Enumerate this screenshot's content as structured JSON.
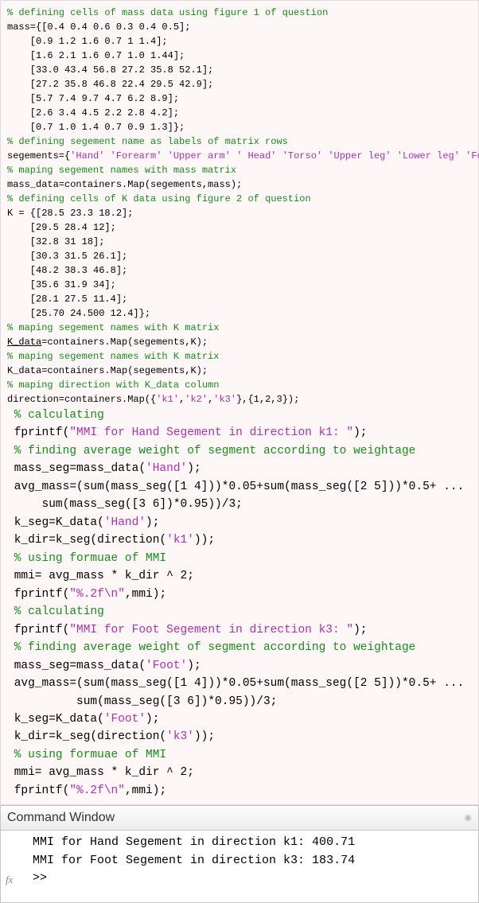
{
  "editor": {
    "lines": [
      {
        "cls": "line",
        "tokens": [
          {
            "t": "comment",
            "v": "% defining cells of mass data using figure 1 of question"
          }
        ]
      },
      {
        "cls": "line",
        "tokens": [
          {
            "v": "mass={[0.4 0.4 0.6 0.3 0.4 0.5];"
          }
        ]
      },
      {
        "cls": "line",
        "tokens": [
          {
            "v": "    [0.9 1.2 1.6 0.7 1 1.4];"
          }
        ]
      },
      {
        "cls": "line",
        "tokens": [
          {
            "v": "    [1.6 2.1 1.6 0.7 1.0 1.44];"
          }
        ]
      },
      {
        "cls": "line",
        "tokens": [
          {
            "v": "    [33.0 43.4 56.8 27.2 35.8 52.1];"
          }
        ]
      },
      {
        "cls": "line",
        "tokens": [
          {
            "v": "    [27.2 35.8 46.8 22.4 29.5 42.9];"
          }
        ]
      },
      {
        "cls": "line",
        "tokens": [
          {
            "v": "    [5.7 7.4 9.7 4.7 6.2 8.9];"
          }
        ]
      },
      {
        "cls": "line",
        "tokens": [
          {
            "v": "    [2.6 3.4 4.5 2.2 2.8 4.2];"
          }
        ]
      },
      {
        "cls": "line",
        "tokens": [
          {
            "v": "    [0.7 1.0 1.4 0.7 0.9 1.3]};"
          }
        ]
      },
      {
        "cls": "line",
        "tokens": [
          {
            "t": "comment",
            "v": "% defining segement name as labels of matrix rows"
          }
        ]
      },
      {
        "cls": "line",
        "tokens": [
          {
            "v": "segements={"
          },
          {
            "t": "string",
            "v": "'Hand'"
          },
          {
            "v": " "
          },
          {
            "t": "string",
            "v": "'Forearm'"
          },
          {
            "v": " "
          },
          {
            "t": "string",
            "v": "'Upper arm'"
          },
          {
            "v": " "
          },
          {
            "t": "string",
            "v": "' Head'"
          },
          {
            "v": " "
          },
          {
            "t": "string",
            "v": "'Torso'"
          },
          {
            "v": " "
          },
          {
            "t": "string",
            "v": "'Upper leg'"
          },
          {
            "v": " "
          },
          {
            "t": "string",
            "v": "'Lower leg'"
          },
          {
            "v": " "
          },
          {
            "t": "string",
            "v": "'Foot'"
          },
          {
            "v": "};"
          }
        ]
      },
      {
        "cls": "line",
        "tokens": [
          {
            "v": ""
          }
        ]
      },
      {
        "cls": "line",
        "tokens": [
          {
            "t": "comment",
            "v": "% maping segement names with mass matrix"
          }
        ]
      },
      {
        "cls": "line",
        "tokens": [
          {
            "v": "mass_data=containers.Map(segements,mass);"
          }
        ]
      },
      {
        "cls": "line",
        "tokens": [
          {
            "v": ""
          }
        ]
      },
      {
        "cls": "line",
        "tokens": [
          {
            "t": "comment",
            "v": "% defining cells of K data using figure 2 of question"
          }
        ]
      },
      {
        "cls": "line",
        "tokens": [
          {
            "v": "K = {[28.5 23.3 18.2];"
          }
        ]
      },
      {
        "cls": "line",
        "tokens": [
          {
            "v": "    [29.5 28.4 12];"
          }
        ]
      },
      {
        "cls": "line",
        "tokens": [
          {
            "v": "    [32.8 31 18];"
          }
        ]
      },
      {
        "cls": "line",
        "tokens": [
          {
            "v": "    [30.3 31.5 26.1];"
          }
        ]
      },
      {
        "cls": "line",
        "tokens": [
          {
            "v": "    [48.2 38.3 46.8];"
          }
        ]
      },
      {
        "cls": "line",
        "tokens": [
          {
            "v": "    [35.6 31.9 34];"
          }
        ]
      },
      {
        "cls": "line",
        "tokens": [
          {
            "v": "    [28.1 27.5 11.4];"
          }
        ]
      },
      {
        "cls": "line",
        "tokens": [
          {
            "v": "    [25.70 24.500 12.4]};"
          }
        ]
      },
      {
        "cls": "line",
        "tokens": [
          {
            "v": ""
          }
        ]
      },
      {
        "cls": "line",
        "tokens": [
          {
            "t": "comment",
            "v": "% maping segement names with K matrix"
          }
        ]
      },
      {
        "cls": "line",
        "tokens": [
          {
            "t": "ul",
            "v": "K_data"
          },
          {
            "v": "=containers.Map(segements,K);"
          }
        ]
      },
      {
        "cls": "line",
        "tokens": [
          {
            "v": ""
          }
        ]
      },
      {
        "cls": "line",
        "tokens": [
          {
            "t": "comment",
            "v": "% maping segement names with K matrix"
          }
        ]
      },
      {
        "cls": "line",
        "tokens": [
          {
            "v": "K_data=containers.Map(segements,K);"
          }
        ]
      },
      {
        "cls": "line",
        "tokens": [
          {
            "v": ""
          }
        ]
      },
      {
        "cls": "line",
        "tokens": [
          {
            "t": "comment",
            "v": "% maping direction with K_data column"
          }
        ]
      },
      {
        "cls": "line",
        "tokens": [
          {
            "v": "direction=containers.Map({"
          },
          {
            "t": "string",
            "v": "'k1'"
          },
          {
            "v": ","
          },
          {
            "t": "string",
            "v": "'k2'"
          },
          {
            "v": ","
          },
          {
            "t": "string",
            "v": "'k3'"
          },
          {
            "v": "},{1,2,3});"
          }
        ]
      },
      {
        "cls": "line",
        "tokens": [
          {
            "v": ""
          }
        ]
      },
      {
        "cls": "line-wide",
        "tokens": [
          {
            "v": " "
          },
          {
            "t": "comment",
            "v": "% calculating"
          }
        ]
      },
      {
        "cls": "line-wide",
        "tokens": [
          {
            "v": " fprintf("
          },
          {
            "t": "string",
            "v": "\"MMI for Hand Segement in direction k1: \""
          },
          {
            "v": ");"
          }
        ]
      },
      {
        "cls": "line-wide",
        "tokens": [
          {
            "v": " "
          },
          {
            "t": "comment",
            "v": "% finding average weight of segment according to weightage"
          }
        ]
      },
      {
        "cls": "line-wide",
        "tokens": [
          {
            "v": " mass_seg=mass_data("
          },
          {
            "t": "string",
            "v": "'Hand'"
          },
          {
            "v": ");"
          }
        ]
      },
      {
        "cls": "line-wide",
        "tokens": [
          {
            "v": " avg_mass=(sum(mass_seg([1 4]))*0.05+sum(mass_seg([2 5]))*0.5+ ..."
          }
        ]
      },
      {
        "cls": "line-wide",
        "tokens": [
          {
            "v": "     sum(mass_seg([3 6])*0.95))/3;"
          }
        ]
      },
      {
        "cls": "line-wide",
        "tokens": [
          {
            "v": " k_seg=K_data("
          },
          {
            "t": "string",
            "v": "'Hand'"
          },
          {
            "v": ");"
          }
        ]
      },
      {
        "cls": "line-wide",
        "tokens": [
          {
            "v": " k_dir=k_seg(direction("
          },
          {
            "t": "string",
            "v": "'k1'"
          },
          {
            "v": "));"
          }
        ]
      },
      {
        "cls": "line-wide",
        "tokens": [
          {
            "v": " "
          },
          {
            "t": "comment",
            "v": "% using formuae of MMI"
          }
        ]
      },
      {
        "cls": "line-wide",
        "tokens": [
          {
            "v": " mmi= avg_mass * k_dir ^ 2;"
          }
        ]
      },
      {
        "cls": "line-wide",
        "tokens": [
          {
            "v": " fprintf("
          },
          {
            "t": "string",
            "v": "\"%.2f\\n\""
          },
          {
            "v": ",mmi);"
          }
        ]
      },
      {
        "cls": "line-wide",
        "tokens": [
          {
            "v": ""
          }
        ]
      },
      {
        "cls": "line-wide",
        "tokens": [
          {
            "v": " "
          },
          {
            "t": "comment",
            "v": "% calculating"
          }
        ]
      },
      {
        "cls": "line-wide",
        "tokens": [
          {
            "v": " fprintf("
          },
          {
            "t": "string",
            "v": "\"MMI for Foot Segement in direction k3: \""
          },
          {
            "v": ");"
          }
        ]
      },
      {
        "cls": "line-wide",
        "tokens": [
          {
            "v": " "
          },
          {
            "t": "comment",
            "v": "% finding average weight of segment according to weightage"
          }
        ]
      },
      {
        "cls": "line-wide",
        "tokens": [
          {
            "v": " mass_seg=mass_data("
          },
          {
            "t": "string",
            "v": "'Foot'"
          },
          {
            "v": ");"
          }
        ]
      },
      {
        "cls": "line-wide",
        "tokens": [
          {
            "v": " avg_mass=(sum(mass_seg([1 4]))*0.05+sum(mass_seg([2 5]))*0.5+ ..."
          }
        ]
      },
      {
        "cls": "line-wide",
        "tokens": [
          {
            "v": "          sum(mass_seg([3 6])*0.95))/3;"
          }
        ]
      },
      {
        "cls": "line-wide",
        "tokens": [
          {
            "v": " k_seg=K_data("
          },
          {
            "t": "string",
            "v": "'Foot'"
          },
          {
            "v": ");"
          }
        ]
      },
      {
        "cls": "line-wide",
        "tokens": [
          {
            "v": " k_dir=k_seg(direction("
          },
          {
            "t": "string",
            "v": "'k3'"
          },
          {
            "v": "));"
          }
        ]
      },
      {
        "cls": "line-wide",
        "tokens": [
          {
            "v": " "
          },
          {
            "t": "comment",
            "v": "% using formuae of MMI"
          }
        ]
      },
      {
        "cls": "line-wide",
        "tokens": [
          {
            "v": " mmi= avg_mass * k_dir ^ 2;"
          }
        ]
      },
      {
        "cls": "line-wide",
        "tokens": [
          {
            "v": " fprintf("
          },
          {
            "t": "string",
            "v": "\"%.2f\\n\""
          },
          {
            "v": ",mmi);"
          }
        ]
      }
    ]
  },
  "command_window": {
    "title": "Command Window",
    "output": [
      "MMI for Hand Segement in direction k1: 400.71",
      "MMI for Foot Segement in direction k3: 183.74"
    ],
    "prompt": ">> ",
    "fx_label": "fx"
  }
}
